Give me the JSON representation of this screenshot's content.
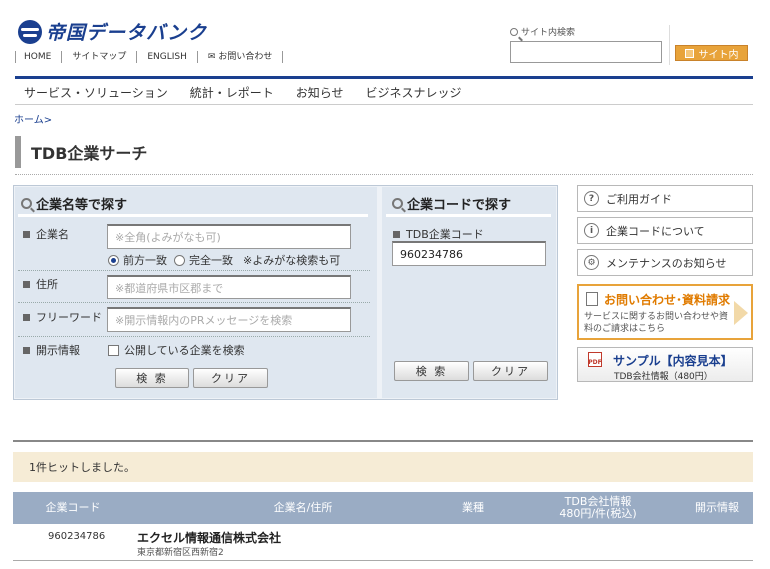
{
  "header": {
    "logo_text": "帝国データバンク",
    "top_nav": [
      "HOME",
      "サイトマップ",
      "ENGLISH",
      "お問い合わせ"
    ],
    "site_search_label": "サイト内検索",
    "site_search_button": "サイト内"
  },
  "main_nav": [
    "サービス・ソリューション",
    "統計・レポート",
    "お知らせ",
    "ビジネスナレッジ"
  ],
  "breadcrumb": "ホーム>",
  "page_title": "TDB企業サーチ",
  "search_by_name": {
    "heading": "企業名等で探す",
    "company_label": "企業名",
    "company_placeholder": "※全角(よみがなも可)",
    "match_prefix": "前方一致",
    "match_exact": "完全一致",
    "match_note": "※よみがな検索も可",
    "address_label": "住所",
    "address_placeholder": "※都道府県市区郡まで",
    "freeword_label": "フリーワード",
    "freeword_placeholder": "※開示情報内のPRメッセージを検索",
    "disclosure_label": "開示情報",
    "disclosure_checkbox": "公開している企業を検索",
    "search_button": "検 索",
    "clear_button": "クリア"
  },
  "search_by_code": {
    "heading": "企業コードで探す",
    "code_label": "TDB企業コード",
    "code_value": "960234786",
    "search_button": "検 索",
    "clear_button": "クリア"
  },
  "side_links": {
    "guide": "ご利用ガイド",
    "about_code": "企業コードについて",
    "maintenance": "メンテナンスのお知らせ",
    "contact_title": "お問い合わせ･資料請求",
    "contact_desc": "サービスに関するお問い合わせや資料のご請求はこちら",
    "sample_title": "サンプル【内容見本】",
    "sample_sub": "TDB会社情報（480円）"
  },
  "results": {
    "hit_text": "1件ヒットしました。",
    "columns": [
      "企業コード",
      "企業名/住所",
      "業種",
      "TDB会社情報",
      "480円/件(税込)",
      "開示情報"
    ],
    "rows": [
      {
        "code": "960234786",
        "name": "エクセル情報通信株式会社",
        "address": "東京都新宿区西新宿2"
      }
    ]
  },
  "colors": {
    "brand_blue": "#1a3f8f",
    "accent_orange": "#e8a33a",
    "table_header": "#9aacc4",
    "panel_bg": "#dfe7f0",
    "hits_bg": "#f6ecd6"
  }
}
